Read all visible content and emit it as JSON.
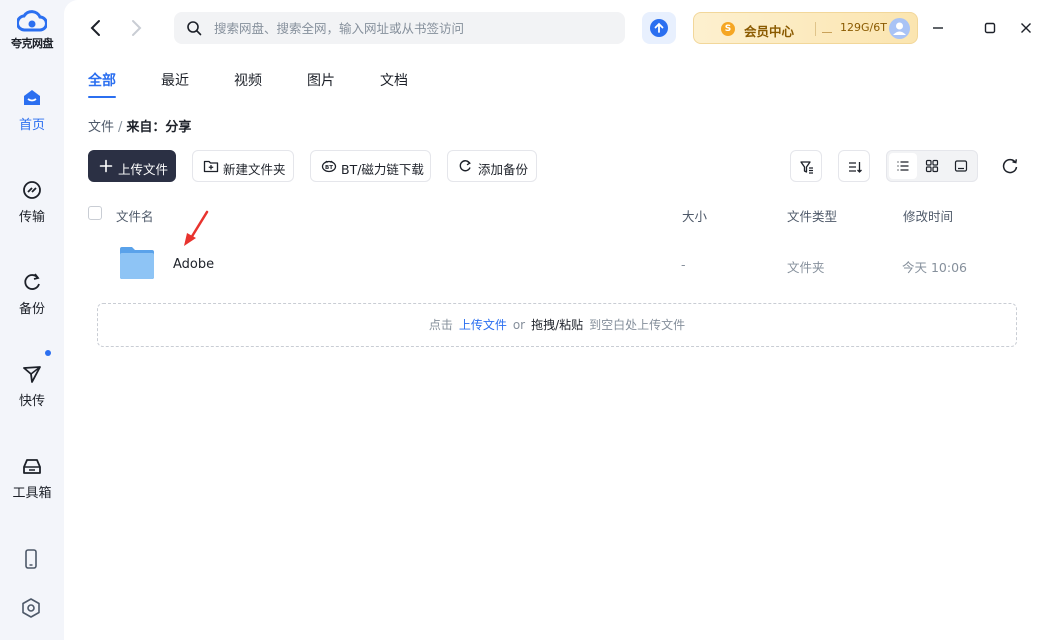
{
  "app": {
    "name": "夸克网盘"
  },
  "sidebar": {
    "items": [
      {
        "label": "首页",
        "icon": "home-icon"
      },
      {
        "label": "传输",
        "icon": "transfer-icon"
      },
      {
        "label": "备份",
        "icon": "backup-icon"
      },
      {
        "label": "快传",
        "icon": "send-icon"
      },
      {
        "label": "工具箱",
        "icon": "toolbox-icon"
      }
    ],
    "bottom_icons": [
      "phone-icon",
      "settings-icon"
    ]
  },
  "topbar": {
    "search_placeholder": "搜索网盘、搜索全网，输入网址或从书签访问",
    "vip": {
      "coin": "S",
      "label": "会员中心",
      "quota": "129G/6T"
    }
  },
  "tabs": [
    "全部",
    "最近",
    "视频",
    "图片",
    "文档"
  ],
  "breadcrumb": {
    "root": "文件",
    "current": "来自：分享"
  },
  "toolbar": {
    "upload": "上传文件",
    "new_folder": "新建文件夹",
    "bt_download": "BT/磁力链下载",
    "add_backup": "添加备份"
  },
  "table": {
    "headers": {
      "name": "文件名",
      "size": "大小",
      "type": "文件类型",
      "modified": "修改时间"
    },
    "rows": [
      {
        "name": "Adobe",
        "size": "-",
        "type": "文件夹",
        "modified": "今天 10:06"
      }
    ]
  },
  "dropzone": {
    "prefix": "点击",
    "link": "上传文件",
    "or": "or",
    "action": "拖拽/粘贴",
    "suffix": "到空白处上传文件"
  },
  "colors": {
    "accent": "#2b6ff0",
    "primary_button": "#2b3044",
    "vip_bg": "#fdf0cf",
    "annotation_arrow": "#e8332e"
  }
}
